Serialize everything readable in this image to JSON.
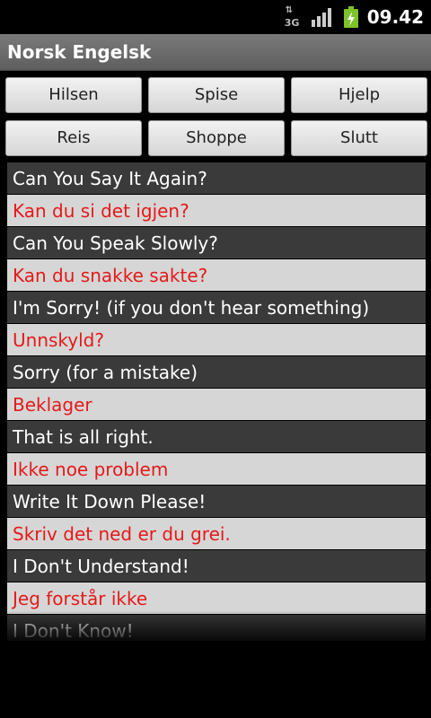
{
  "status_bar": {
    "network_type": "3G",
    "time": "09.42",
    "icons": [
      "network-3g-icon",
      "signal-strength-icon",
      "battery-charging-icon"
    ]
  },
  "app": {
    "title": "Norsk Engelsk"
  },
  "buttons": [
    {
      "label": "Hilsen"
    },
    {
      "label": "Spise"
    },
    {
      "label": "Hjelp"
    },
    {
      "label": "Reis"
    },
    {
      "label": "Shoppe"
    },
    {
      "label": "Slutt"
    }
  ],
  "phrases": [
    {
      "en": "Can You Say It Again?",
      "no": "Kan du si det igjen?"
    },
    {
      "en": "Can You Speak Slowly?",
      "no": "Kan du snakke sakte?"
    },
    {
      "en": "I'm Sorry! (if you don't hear something)",
      "no": "Unnskyld?"
    },
    {
      "en": "Sorry (for a mistake)",
      "no": "Beklager"
    },
    {
      "en": "That is all right.",
      "no": "Ikke noe problem"
    },
    {
      "en": "Write It Down Please!",
      "no": "Skriv det ned er du grei."
    },
    {
      "en": "I Don't Understand!",
      "no": "Jeg forstår ikke"
    },
    {
      "en": "I Don't Know!",
      "no": ""
    }
  ],
  "colors": {
    "english_row_bg": "#3a3a3a",
    "english_text": "#ffffff",
    "norwegian_row_bg": "#d6d6d6",
    "norwegian_text": "#e41a1a",
    "battery": "#7ec12b"
  }
}
